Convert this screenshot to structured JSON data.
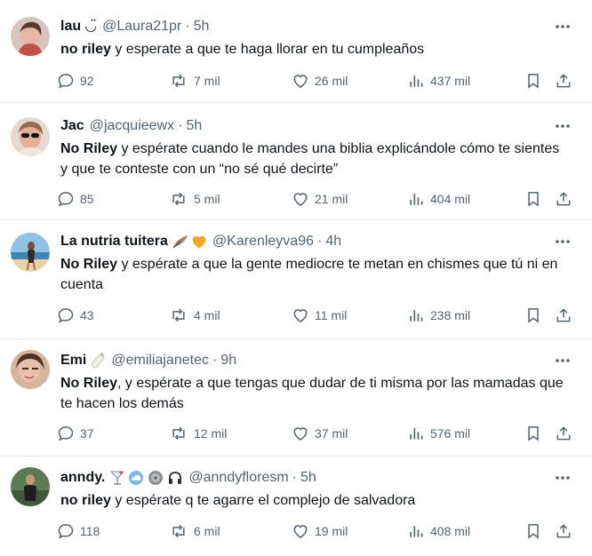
{
  "tweets": [
    {
      "name": "lau",
      "name_emoji": "◡̈",
      "handle": "@Laura21pr",
      "time": "5h",
      "bold": "no riley",
      "text": " y esperate a que te haga llorar en tu cumpleaños",
      "replies": "92",
      "retweets": "7 mil",
      "likes": "26 mil",
      "views": "437 mil"
    },
    {
      "name": "Jac",
      "name_emoji": "",
      "handle": "@jacquieewx",
      "time": "5h",
      "bold": "No Riley",
      "text": " y espérate cuando le mandes una biblia explicándole cómo te sientes y que te conteste con un “no sé qué decirte”",
      "replies": "85",
      "retweets": "5 mil",
      "likes": "21 mil",
      "views": "404 mil"
    },
    {
      "name": "La nutria tuitera",
      "name_emoji": "",
      "handle": "@Karenleyva96",
      "time": "4h",
      "bold": "No Riley",
      "text": " y espérate a que la gente mediocre te metan en chismes que tú ni en cuenta",
      "replies": "43",
      "retweets": "4 mil",
      "likes": "11 mil",
      "views": "238 mil"
    },
    {
      "name": "Emi",
      "name_emoji": "",
      "handle": "@emiliajanetec",
      "time": "9h",
      "bold": "No Riley",
      "text": ", y espérate a que tengas que dudar de ti misma por las mamadas que te hacen los demás",
      "replies": "37",
      "retweets": "12 mil",
      "likes": "37 mil",
      "views": "576 mil"
    },
    {
      "name": "anndy.",
      "name_emoji": "",
      "handle": "@anndyfloresm",
      "time": "5h",
      "bold": "no riley",
      "text": " y espérate q te agarre el complejo de salvadora",
      "replies": "118",
      "retweets": "6 mil",
      "likes": "19 mil",
      "views": "408 mil"
    }
  ],
  "separator": "·",
  "colors": {
    "text": "#0f1419",
    "secondary": "#536471",
    "divider": "#e6e9eb",
    "background": "#ffffff"
  },
  "icons": [
    "reply-icon",
    "retweet-icon",
    "like-icon",
    "views-icon",
    "bookmark-icon",
    "share-icon",
    "more-icon"
  ]
}
